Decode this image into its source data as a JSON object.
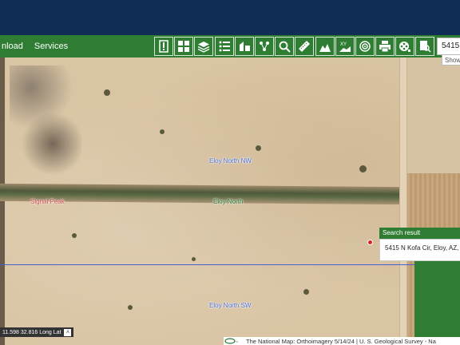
{
  "menu": {
    "items": [
      "nload",
      "Services"
    ]
  },
  "tools": [
    {
      "icon": "info-icon"
    },
    {
      "icon": "basemap-gallery-icon"
    },
    {
      "icon": "layers-icon"
    },
    {
      "icon": "legend-list-icon"
    },
    {
      "icon": "shapes-icon"
    },
    {
      "icon": "network-icon"
    },
    {
      "icon": "query-magnifier-icon"
    },
    {
      "icon": "measure-ruler-icon"
    },
    {
      "icon": "profile-icon",
      "label": "Profile"
    },
    {
      "icon": "xy-elevation-icon",
      "label": "XY"
    },
    {
      "icon": "target-icon"
    },
    {
      "icon": "print-icon"
    },
    {
      "icon": "film-reel-icon"
    },
    {
      "icon": "magnifier-doc-icon"
    }
  ],
  "search": {
    "value": "5415"
  },
  "show_more": "Show r",
  "map_labels": {
    "eloy_nw": "Eloy North NW",
    "eloy_north": "Eloy North",
    "signal_peak": "Signal Peak",
    "eloy_sw": "Eloy North SW"
  },
  "popup": {
    "title": "Search result",
    "address": "5415 N Kofa Cir, Eloy, AZ, 8"
  },
  "coords": {
    "text": "11.598 32.816 Long Lat"
  },
  "attribution": {
    "text": "The National Map: Orthoimagery 5/14/24 | U. S. Geological Survey - Na"
  },
  "colors": {
    "toolbar": "#2e7d32",
    "banner": "#0f2d55",
    "marker": "#e02020"
  }
}
